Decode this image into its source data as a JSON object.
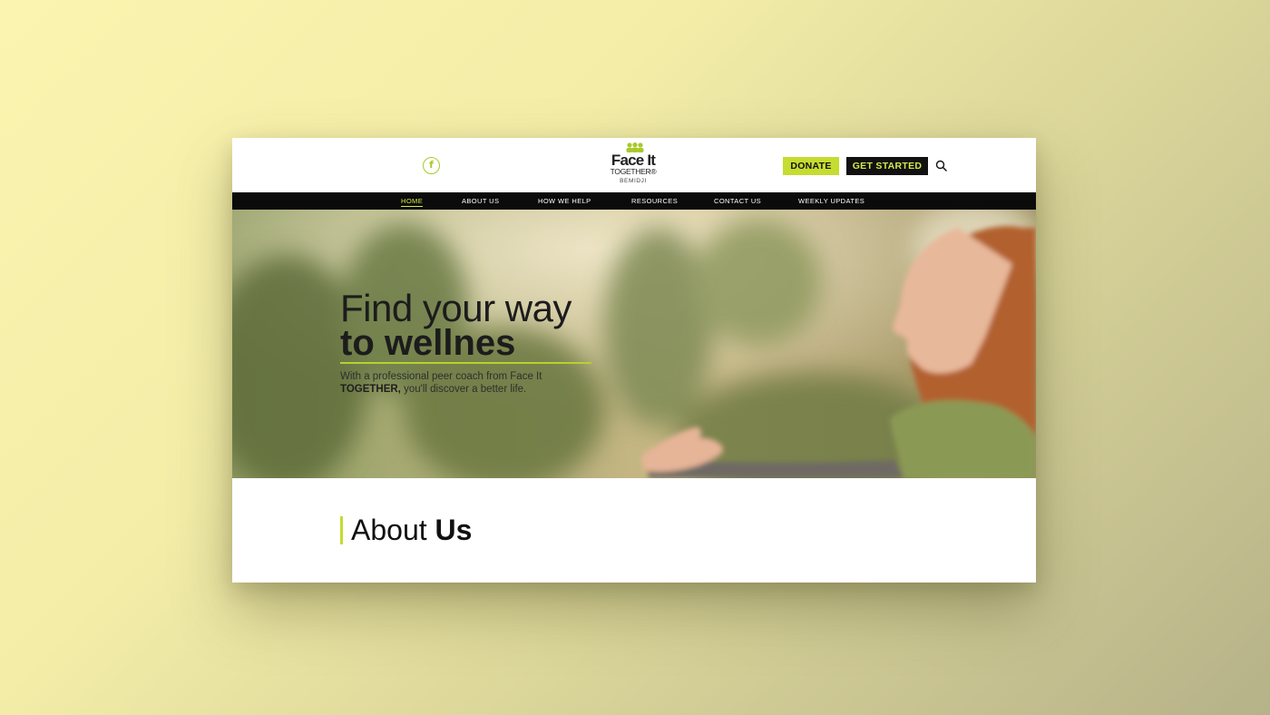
{
  "colors": {
    "accent": "#c5dc30",
    "accent_text": "#d4e84a",
    "nav_bg": "#0b0b0b",
    "text_dark": "#111111"
  },
  "header": {
    "social_icon": "facebook-icon",
    "social_glyph": "f",
    "logo": {
      "main": "Face It",
      "sub": "TOGETHER®",
      "city": "BEMIDJI"
    },
    "donate_label": "DONATE",
    "get_started_label": "GET STARTED",
    "search_icon": "search-icon"
  },
  "nav": {
    "items": [
      {
        "label": "HOME",
        "active": true
      },
      {
        "label": "ABOUT US"
      },
      {
        "label": "HOW WE HELP"
      },
      {
        "label": "RESOURCES"
      },
      {
        "label": "CONTACT US"
      },
      {
        "label": "WEEKLY UPDATES"
      }
    ]
  },
  "hero": {
    "title_line1": "Find your way",
    "title_line2": "to wellnes",
    "subtitle_line1": "With a professional peer coach from Face It",
    "subtitle_bold": "TOGETHER,",
    "subtitle_rest": " you'll discover a better life."
  },
  "about": {
    "title_light": "About ",
    "title_bold": "Us"
  }
}
